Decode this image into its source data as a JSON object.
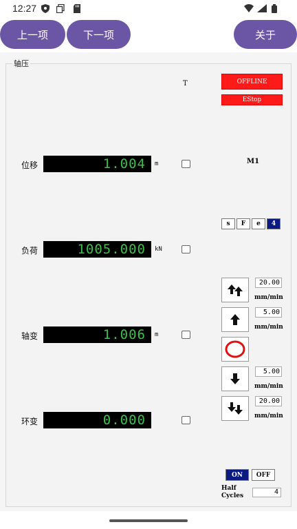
{
  "status_bar": {
    "time": "12:27"
  },
  "nav": {
    "prev": "上一项",
    "next": "下一项",
    "close": "关于"
  },
  "panel": {
    "title": "轴压",
    "t_label": "T",
    "offline": "OFFLINE",
    "estop": "EStop",
    "mode": "M1",
    "segments": [
      "s",
      "F",
      "e",
      "4"
    ],
    "rows": [
      {
        "label": "位移",
        "value": "1.004",
        "unit": "m"
      },
      {
        "label": "负荷",
        "value": "1005.000",
        "unit": "kN"
      },
      {
        "label": "轴变",
        "value": "1.006",
        "unit": "m"
      },
      {
        "label": "环变",
        "value": "0.000",
        "unit": ""
      }
    ],
    "speeds": [
      {
        "value": "20.00",
        "unit": "mm/min"
      },
      {
        "value": "5.00",
        "unit": "mm/min"
      },
      {
        "value": "5.00",
        "unit": "mm/min"
      },
      {
        "value": "20.00",
        "unit": "mm/min"
      }
    ],
    "on": "ON",
    "off": "OFF",
    "half_cycles_line1": "Half",
    "half_cycles_line2": "Cycles",
    "half_cycles_value": "4"
  },
  "colors": {
    "accent": "#6b55a5",
    "alarm": "#ff1a1a",
    "selected": "#0b1b82",
    "lcd_text": "#39c24a"
  }
}
